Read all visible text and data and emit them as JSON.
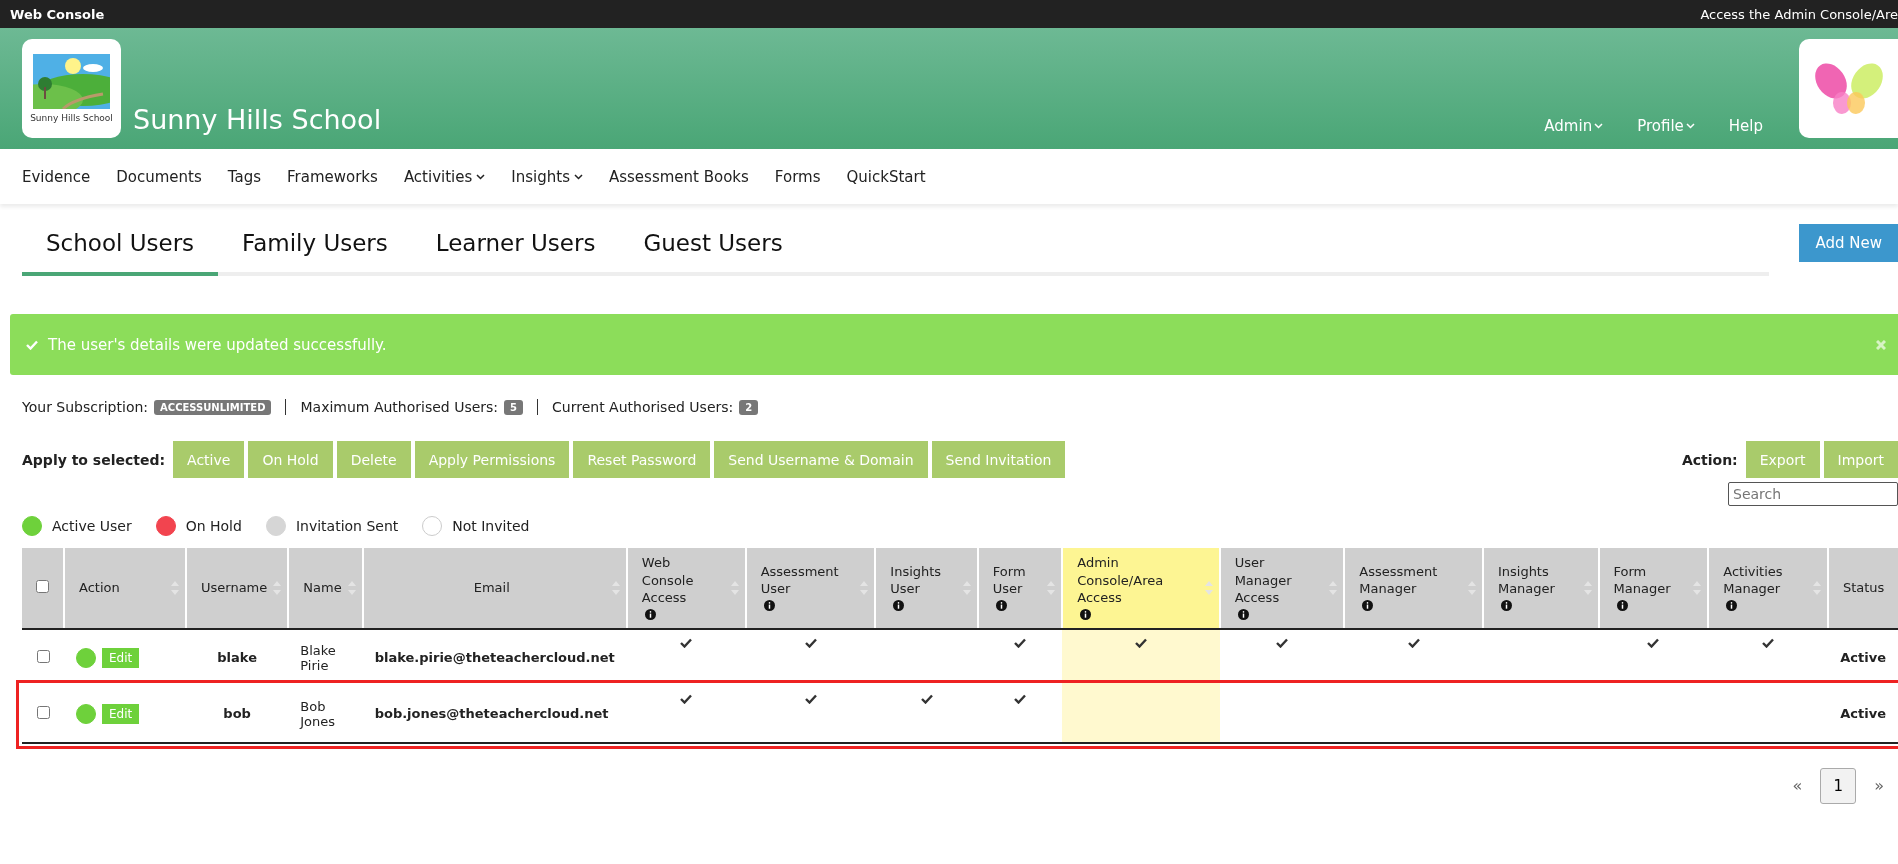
{
  "top_bar": {
    "title": "Web Console",
    "tooltip": "Access the Admin Console/Are"
  },
  "header": {
    "school_name": "Sunny Hills School",
    "logo_caption": "Sunny Hills School",
    "menu": [
      {
        "label": "Admin",
        "dropdown": true
      },
      {
        "label": "Profile",
        "dropdown": true
      },
      {
        "label": "Help",
        "dropdown": false
      }
    ]
  },
  "nav": [
    {
      "label": "Evidence",
      "dropdown": false
    },
    {
      "label": "Documents",
      "dropdown": false
    },
    {
      "label": "Tags",
      "dropdown": false
    },
    {
      "label": "Frameworks",
      "dropdown": false
    },
    {
      "label": "Activities",
      "dropdown": true
    },
    {
      "label": "Insights",
      "dropdown": true
    },
    {
      "label": "Assessment Books",
      "dropdown": false
    },
    {
      "label": "Forms",
      "dropdown": false
    },
    {
      "label": "QuickStart",
      "dropdown": false
    }
  ],
  "tabs": [
    {
      "label": "School Users",
      "selected": true
    },
    {
      "label": "Family Users",
      "selected": false
    },
    {
      "label": "Learner Users",
      "selected": false
    },
    {
      "label": "Guest Users",
      "selected": false
    }
  ],
  "add_button": "Add New",
  "alert": {
    "message": "The user's details were updated successfully."
  },
  "subscription": [
    {
      "label": "Your Subscription:",
      "badge": "ACCESSUNLIMITED"
    },
    {
      "label": "Maximum Authorised Users:",
      "badge": "5"
    },
    {
      "label": "Current Authorised Users:",
      "badge": "2"
    }
  ],
  "apply": {
    "label": "Apply to selected:",
    "buttons": [
      "Active",
      "On Hold",
      "Delete",
      "Apply Permissions",
      "Reset Password",
      "Send Username & Domain",
      "Send Invitation"
    ]
  },
  "action": {
    "label": "Action:",
    "buttons": [
      "Export",
      "Import"
    ]
  },
  "search": {
    "placeholder": "Search"
  },
  "legend": [
    {
      "label": "Active User",
      "color": "#6ed13b"
    },
    {
      "label": "On Hold",
      "color": "#f2444f"
    },
    {
      "label": "Invitation Sent",
      "color": "#d6d6d6"
    },
    {
      "label": "Not Invited",
      "color": "#ffffff"
    }
  ],
  "table": {
    "select_all": {
      "checked": false
    },
    "columns": [
      {
        "label": "Action"
      },
      {
        "label": "Username"
      },
      {
        "label": "Name"
      },
      {
        "label": "Email"
      }
    ],
    "permission_columns": [
      {
        "label": "Web Console Access",
        "highlighted": false
      },
      {
        "label": "Assessment User",
        "highlighted": false
      },
      {
        "label": "Insights User",
        "highlighted": false
      },
      {
        "label": "Form User",
        "highlighted": false
      },
      {
        "label": "Admin Console/Area Access",
        "highlighted": true
      },
      {
        "label": "User Manager Access",
        "highlighted": false
      },
      {
        "label": "Assessment Manager",
        "highlighted": false
      },
      {
        "label": "Insights Manager",
        "highlighted": false
      },
      {
        "label": "Form Manager",
        "highlighted": false
      },
      {
        "label": "Activities Manager",
        "highlighted": false
      }
    ],
    "status_column": "Status",
    "rows": [
      {
        "checked": false,
        "color": "#6ed13b",
        "edit": "Edit",
        "username": "blake",
        "name": "Blake Pirie",
        "email": "blake.pirie@theteachercloud.net",
        "permissions": [
          true,
          true,
          false,
          true,
          true,
          true,
          true,
          false,
          true,
          true
        ],
        "status": "Active",
        "outlined": false
      },
      {
        "checked": false,
        "color": "#6ed13b",
        "edit": "Edit",
        "username": "bob",
        "name": "Bob Jones",
        "email": "bob.jones@theteachercloud.net",
        "permissions": [
          true,
          true,
          true,
          true,
          false,
          false,
          false,
          false,
          false,
          false
        ],
        "status": "Active",
        "outlined": true
      }
    ]
  },
  "pagination": {
    "prev": "«",
    "next": "»",
    "pages": [
      {
        "label": "1",
        "selected": true
      }
    ]
  }
}
